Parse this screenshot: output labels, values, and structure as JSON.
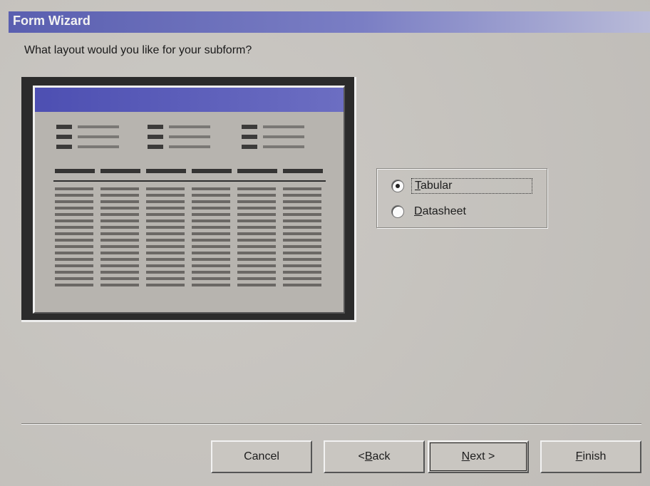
{
  "window": {
    "title": "Form Wizard"
  },
  "prompt": {
    "question": "What layout would you like for your subform?"
  },
  "layout_options": [
    {
      "pre": "",
      "accel": "T",
      "rest": "abular",
      "selected": true
    },
    {
      "pre": "",
      "accel": "D",
      "rest": "atasheet",
      "selected": false
    }
  ],
  "buttons": {
    "cancel": {
      "pre": "Cancel",
      "accel": "",
      "rest": ""
    },
    "back": {
      "pre": "< ",
      "accel": "B",
      "rest": "ack"
    },
    "next": {
      "pre": "",
      "accel": "N",
      "rest": "ext >"
    },
    "finish": {
      "pre": "",
      "accel": "F",
      "rest": "inish"
    }
  },
  "colors": {
    "title_bar": "#5a5fb0",
    "preview_title": "#4d4fb2",
    "dialog_bg": "#c7c4bf"
  }
}
